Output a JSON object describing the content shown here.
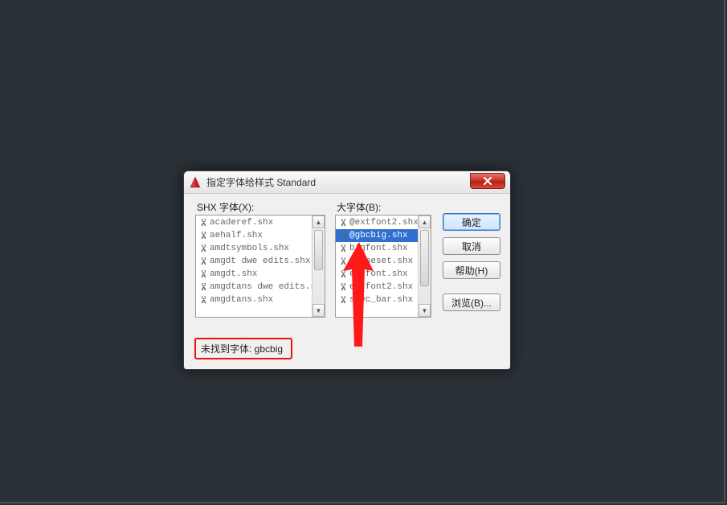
{
  "dialog": {
    "title": "指定字体给样式 Standard",
    "left_label": "SHX 字体(X):",
    "right_label": "大字体(B):",
    "status_text": "未找到字体: gbcbig"
  },
  "buttons": {
    "ok": "确定",
    "cancel": "取消",
    "help": "帮助(H)",
    "browse": "浏览(B)..."
  },
  "shx_fonts": [
    "acaderef.shx",
    "aehalf.shx",
    "amdtsymbols.shx",
    "amgdt dwe edits.shx",
    "amgdt.shx",
    "amgdtans dwe edits.shx",
    "amgdtans.shx"
  ],
  "big_fonts": [
    "@extfont2.shx",
    "@gbcbig.shx",
    "bigfont.shx",
    "chineset.shx",
    "extfont.shx",
    "extfont2.shx",
    "spec_bar.shx"
  ],
  "selected_big_font_index": 1
}
